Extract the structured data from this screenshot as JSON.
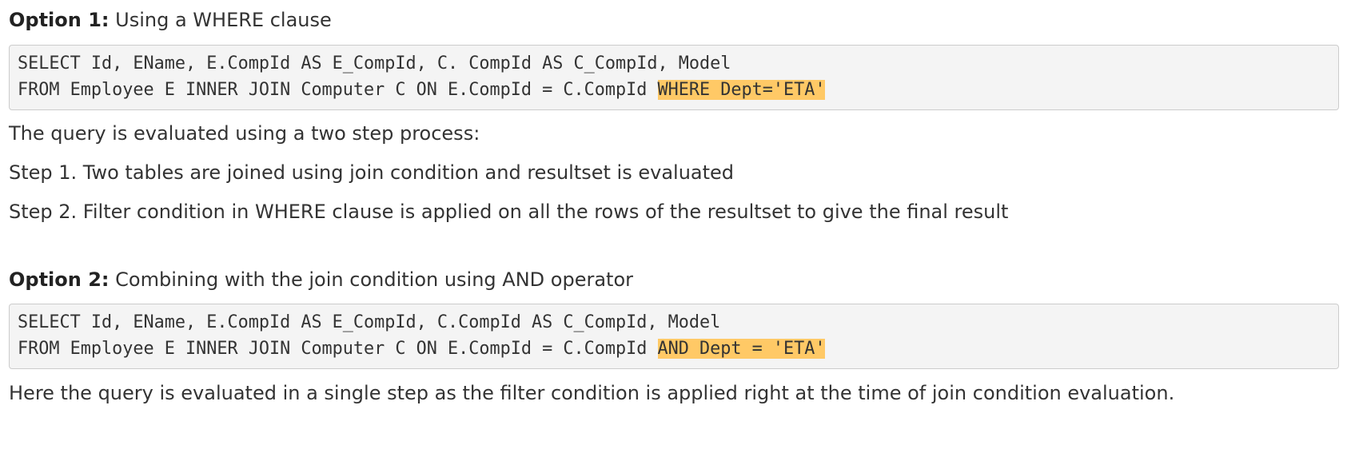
{
  "option1": {
    "label": "Option 1:",
    "title": " Using a WHERE clause",
    "code_line1": "SELECT Id, EName, E.CompId AS E_CompId, C. CompId AS C_CompId, Model",
    "code_line2_plain": "FROM Employee E INNER JOIN Computer C ON E.CompId = C.CompId ",
    "code_line2_highlight": "WHERE Dept='ETA'"
  },
  "explanation1": {
    "intro": "The query is evaluated using a two step process:",
    "step1": "Step 1. Two tables are joined using join condition and resultset is evaluated",
    "step2": "Step 2. Filter condition in WHERE clause is applied on all the rows of the resultset to give the final result"
  },
  "option2": {
    "label": "Option 2:",
    "title": " Combining with the join condition using AND operator",
    "code_line1": "SELECT Id, EName, E.CompId AS E_CompId, C.CompId AS C_CompId, Model",
    "code_line2_plain": "FROM Employee E INNER JOIN Computer C ON E.CompId = C.CompId ",
    "code_line2_highlight": "AND Dept = 'ETA'"
  },
  "explanation2": {
    "text": "Here the query is evaluated in a single step as the filter condition is applied right at the time of join condition evaluation."
  },
  "colors": {
    "highlight": "#ffc966",
    "code_background": "#f4f4f4",
    "code_border": "#cccccc",
    "text": "#333333"
  }
}
